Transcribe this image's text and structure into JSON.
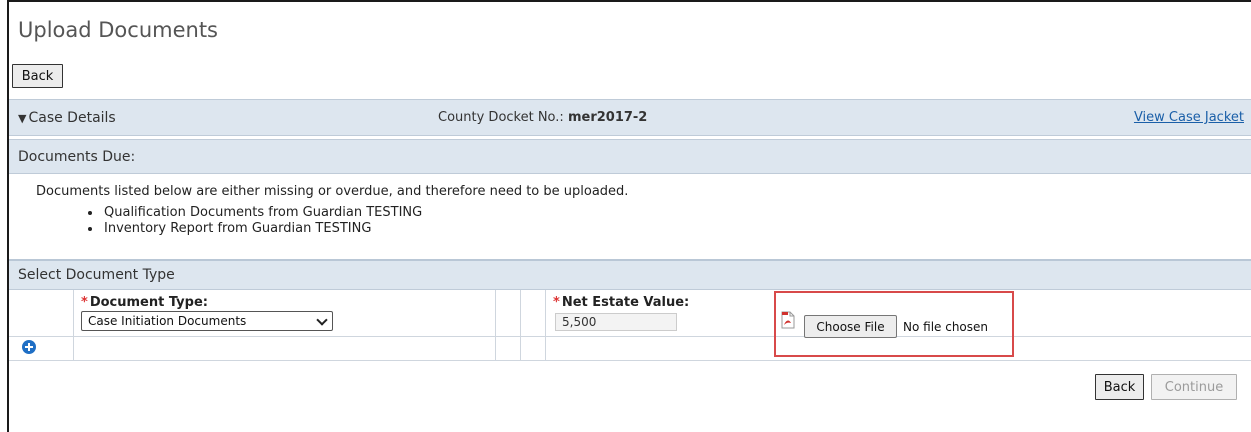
{
  "page": {
    "title": "Upload Documents"
  },
  "buttons": {
    "back_top": "Back",
    "back_bottom": "Back",
    "continue": "Continue"
  },
  "case_details": {
    "label": "Case Details",
    "docket_label": "County Docket No.:",
    "docket_value": "mer2017-2",
    "view_link": "View Case Jacket"
  },
  "documents_due": {
    "label": "Documents Due:",
    "message": "Documents listed below are either missing or overdue, and therefore need to be uploaded.",
    "items": [
      "Qualification Documents from Guardian TESTING",
      "Inventory Report from Guardian TESTING"
    ]
  },
  "select_type": {
    "label": "Select Document Type",
    "doc_type_label": "Document Type:",
    "doc_type_value": "Case Initiation Documents",
    "net_estate_label": "Net Estate Value:",
    "net_estate_value": "5,500",
    "choose_file": "Choose File",
    "no_file": "No file chosen",
    "required_mark": "*"
  },
  "icons": {
    "toggle": "triangle-down-icon",
    "file_type": "pdf-icon",
    "add_row": "plus-circle-icon",
    "select_arrow": "chevron-down-icon"
  },
  "colors": {
    "bar_bg": "#dde6ef",
    "link": "#1a5fa8",
    "required": "#d33",
    "highlight": "#d84a4a",
    "add_icon": "#1f6fc5"
  }
}
